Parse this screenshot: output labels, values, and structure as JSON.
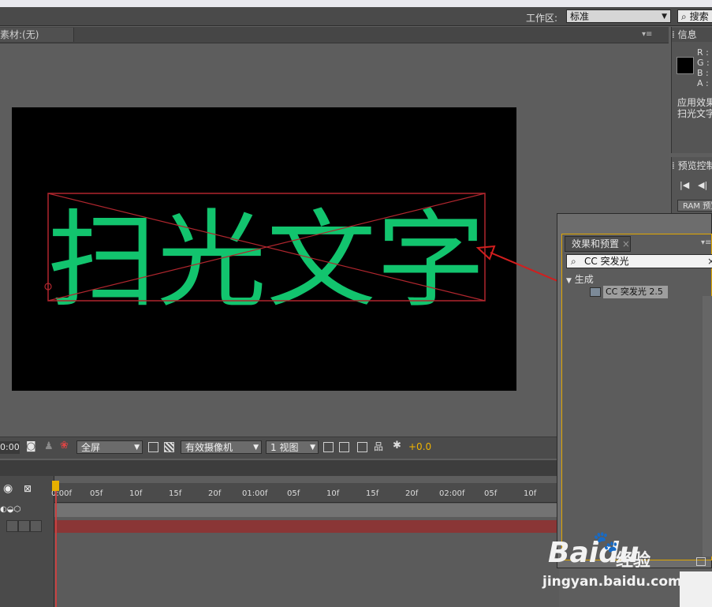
{
  "topbar": {
    "workspace_label": "工作区:",
    "workspace_value": "标准",
    "search_help": "搜索"
  },
  "composition": {
    "footage_tab": "素材:(无)",
    "canvas_text": "扫光文字"
  },
  "info_panel": {
    "tab": "信息",
    "r": "R :",
    "g": "G :",
    "b": "B :",
    "a": "A :",
    "line1": "应用效果",
    "line2": "扫光文字"
  },
  "preview_panel": {
    "tab": "预览控制",
    "ram_button": "RAM 预览"
  },
  "comp_toolbar": {
    "timecode": "0:00",
    "resolution": "全屏",
    "camera": "有效摄像机",
    "views": "1 视图",
    "exposure": "+0.0"
  },
  "timeline": {
    "ticks": [
      "0:00f",
      "05f",
      "10f",
      "15f",
      "20f",
      "01:00f",
      "05f",
      "10f",
      "15f",
      "20f",
      "02:00f",
      "05f",
      "10f"
    ]
  },
  "effects_panel": {
    "tab": "效果和预置",
    "search_value": "CC 突发光",
    "category": "生成",
    "item": "CC 突发光 2.5"
  },
  "watermark": {
    "brand": "Baidu",
    "jingyan": "经验",
    "url": "jingyan.baidu.com"
  },
  "colors": {
    "text_green": "#12c46e",
    "bbox_red": "#b0262e",
    "arrow_red": "#d21e1e",
    "highlight": "#e0a600"
  }
}
